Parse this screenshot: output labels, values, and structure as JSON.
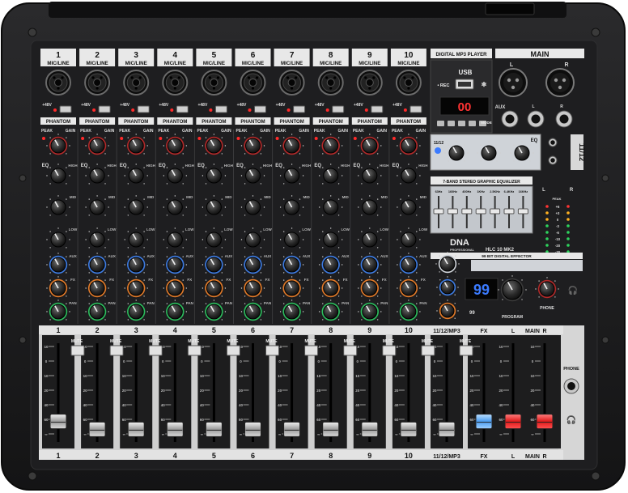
{
  "brand": {
    "logo": "DNA",
    "sub": "PROFESSIONAL",
    "model": "HLC 10 MK2"
  },
  "channels": [
    "1",
    "2",
    "3",
    "4",
    "5",
    "6",
    "7",
    "8",
    "9",
    "10"
  ],
  "strip": {
    "input_label": "MIC/LINE",
    "phantom48": "+48V",
    "phantom": "PHANTOM",
    "peak": "PEAK",
    "gain": "GAIN",
    "eq": "EQ",
    "high": "HIGH",
    "mid": "MID",
    "low": "LOW",
    "aux": "AUX",
    "fx": "FX",
    "pan": "PAN",
    "mute": "MUTE"
  },
  "player": {
    "title": "DIGITAL MP3 PLAYER",
    "usb": "USB",
    "rec": "• REC",
    "display": "00",
    "mode": "MODE",
    "eq": "EQ"
  },
  "main_section": {
    "title": "MAIN",
    "left": "L",
    "right": "R",
    "aux": "AUX",
    "side_label": "11/12"
  },
  "geq": {
    "title": "7-BAND STEREO GRAPHIC EQUALIZER",
    "bands": [
      "63Hz",
      "160Hz",
      "400Hz",
      "1KHz",
      "2.5KHz",
      "6.4KHz",
      "16KHz"
    ]
  },
  "meter": {
    "left": "L",
    "right": "R",
    "peak": "PEAK",
    "scale": [
      "+6",
      "+3",
      "0",
      "-3",
      "-6",
      "-10",
      "-20",
      "-30"
    ]
  },
  "fx": {
    "title": "99 BIT DIGITAL EFFECTOR",
    "display": "99",
    "program": "PROGRAM",
    "phone": "PHONE",
    "small_logo": "99"
  },
  "fader_row": {
    "labels_top": [
      "1",
      "2",
      "3",
      "4",
      "5",
      "6",
      "7",
      "8",
      "9",
      "10",
      "11/12/MP3",
      "FX",
      "L",
      "MAIN",
      "R"
    ],
    "scale": [
      "10",
      "0",
      "10",
      "20",
      "40",
      "60",
      "∞"
    ],
    "phone": "PHONE"
  },
  "colors": {
    "body": "#1b1b1c",
    "panel": "#232325",
    "strip_label_bg": "#e8e8e8",
    "aux_knob": "#3e7be0",
    "fx_knob": "#e07a2a",
    "pan_knob": "#2dbb5d",
    "gain_knob": "#b02a2a",
    "fx_fader_cap": "#6fb6ff",
    "main_fader_cap": "#ff2a2a",
    "display_led": "#ff3333",
    "fx_led": "#3b7bff"
  }
}
